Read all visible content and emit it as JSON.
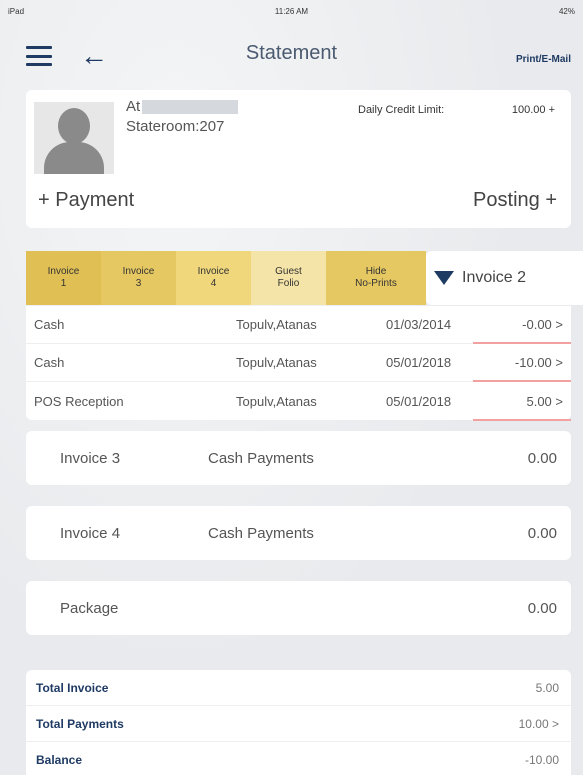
{
  "status_bar": {
    "left": "iPad",
    "time": "11:26 AM",
    "battery": "42%"
  },
  "nav": {
    "title": "Statement",
    "print_label": "Print/E-Mail"
  },
  "guest": {
    "name_prefix": "At",
    "stateroom": "Stateroom:207",
    "credit_label": "Daily Credit Limit:",
    "credit_value": "100.00 +",
    "payment_label": "+ Payment",
    "posting_label": "Posting +"
  },
  "tabs": [
    {
      "label": "Invoice\n1"
    },
    {
      "label": "Invoice\n3"
    },
    {
      "label": "Invoice\n4"
    },
    {
      "label": "Guest\nFolio"
    },
    {
      "label": "Hide\nNo-Prints"
    }
  ],
  "selected_invoice": "Invoice 2",
  "transactions": [
    {
      "type": "Cash",
      "name": "Topulv,Atanas",
      "date": "01/03/2014",
      "amount": "-0.00 >"
    },
    {
      "type": "Cash",
      "name": "Topulv,Atanas",
      "date": "05/01/2018",
      "amount": "-10.00 >"
    },
    {
      "type": "POS Reception",
      "name": "Topulv,Atanas",
      "date": "05/01/2018",
      "amount": "5.00 >"
    }
  ],
  "sections": [
    {
      "name": "Invoice 3",
      "desc": "Cash Payments",
      "amount": "0.00"
    },
    {
      "name": "Invoice 4",
      "desc": "Cash Payments",
      "amount": "0.00"
    },
    {
      "name": "Package",
      "desc": "",
      "amount": "0.00"
    }
  ],
  "totals": [
    {
      "label": "Total Invoice",
      "value": "5.00"
    },
    {
      "label": "Total Payments",
      "value": "10.00 >"
    },
    {
      "label": "Balance",
      "value": "-10.00"
    }
  ]
}
